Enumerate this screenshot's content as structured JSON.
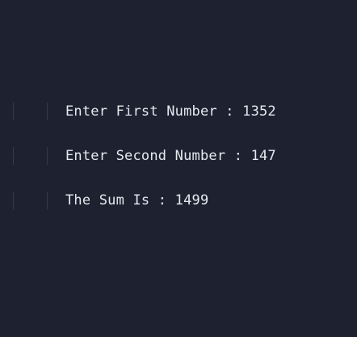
{
  "output": {
    "lines": [
      "Enter First Number : 1352",
      "Enter Second Number : 147",
      "The Sum Is : 1499"
    ]
  }
}
